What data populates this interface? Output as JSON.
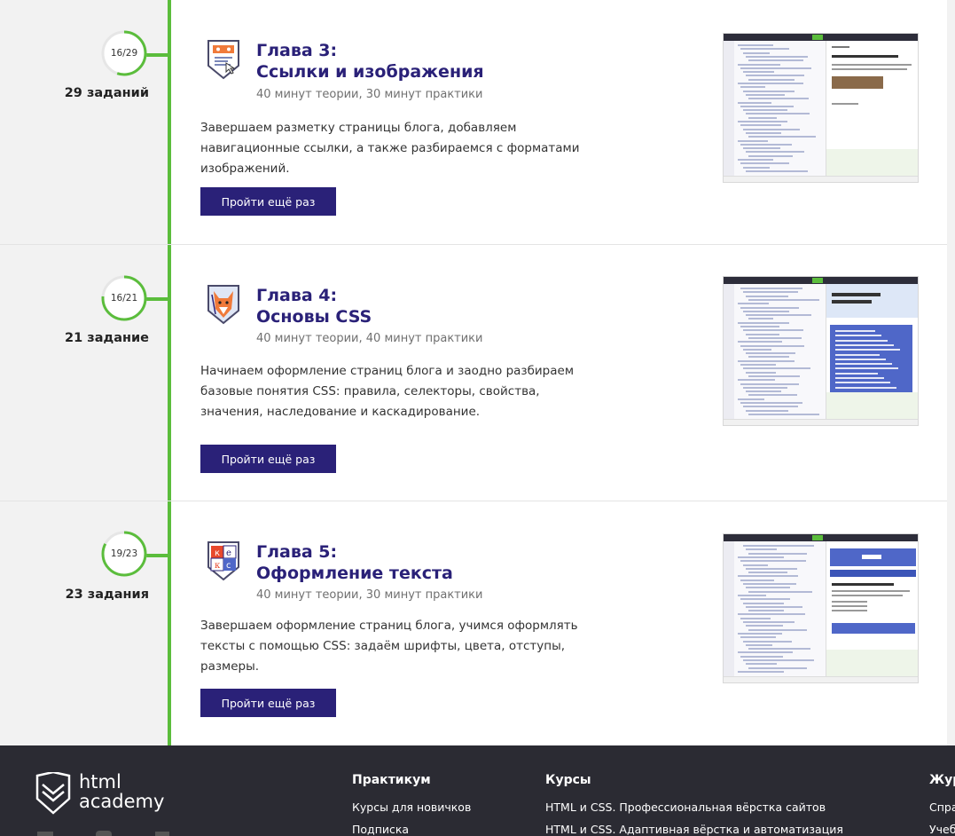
{
  "chapters": [
    {
      "progress": "16/29",
      "progress_fraction": 0.5517,
      "tasks_count": "29 заданий",
      "title_line1": "Глава 3:",
      "title_line2": "Ссылки и изображения",
      "duration": "40 минут теории, 30 минут практики",
      "description": "Завершаем разметку страницы блога, добавляем навигационные ссылки, а также разбираемся с форматами изображений.",
      "button_label": "Пройти ещё раз",
      "badge_icon": "mouse-link-badge-icon"
    },
    {
      "progress": "16/21",
      "progress_fraction": 0.7619,
      "tasks_count": "21 задание",
      "title_line1": "Глава 4:",
      "title_line2": "Основы CSS",
      "duration": "40 минут теории, 40 минут практики",
      "description": "Начинаем оформление страниц блога и заодно разбираем базовые понятия CSS: правила, селекторы, свойства, значения, наследование и каскадирование.",
      "button_label": "Пройти ещё раз",
      "badge_icon": "fox-badge-icon"
    },
    {
      "progress": "19/23",
      "progress_fraction": 0.8261,
      "tasks_count": "23 задания",
      "title_line1": "Глава 5:",
      "title_line2": "Оформление текста",
      "duration": "40 минут теории, 30 минут практики",
      "description": "Завершаем оформление страниц блога, учимся оформлять тексты с помощью CSS: задаём шрифты, цвета, отступы, размеры.",
      "button_label": "Пройти ещё раз",
      "badge_icon": "letters-badge-icon"
    }
  ],
  "footer": {
    "logo_line1": "html",
    "logo_line2": "academy",
    "columns": [
      {
        "heading": "Практикум",
        "links": [
          "Курсы для новичков",
          "Подписка"
        ]
      },
      {
        "heading": "Курсы",
        "links": [
          "HTML и CSS. Профессиональная вёрстка сайтов",
          "HTML и CSS. Адаптивная вёрстка и автоматизация"
        ]
      },
      {
        "heading": "Жур",
        "links": [
          "Спра",
          "Учеб"
        ]
      }
    ]
  },
  "colors": {
    "accent_green": "#5bbd3c",
    "brand_purple": "#2a2178",
    "footer_bg": "#2b2b33"
  }
}
